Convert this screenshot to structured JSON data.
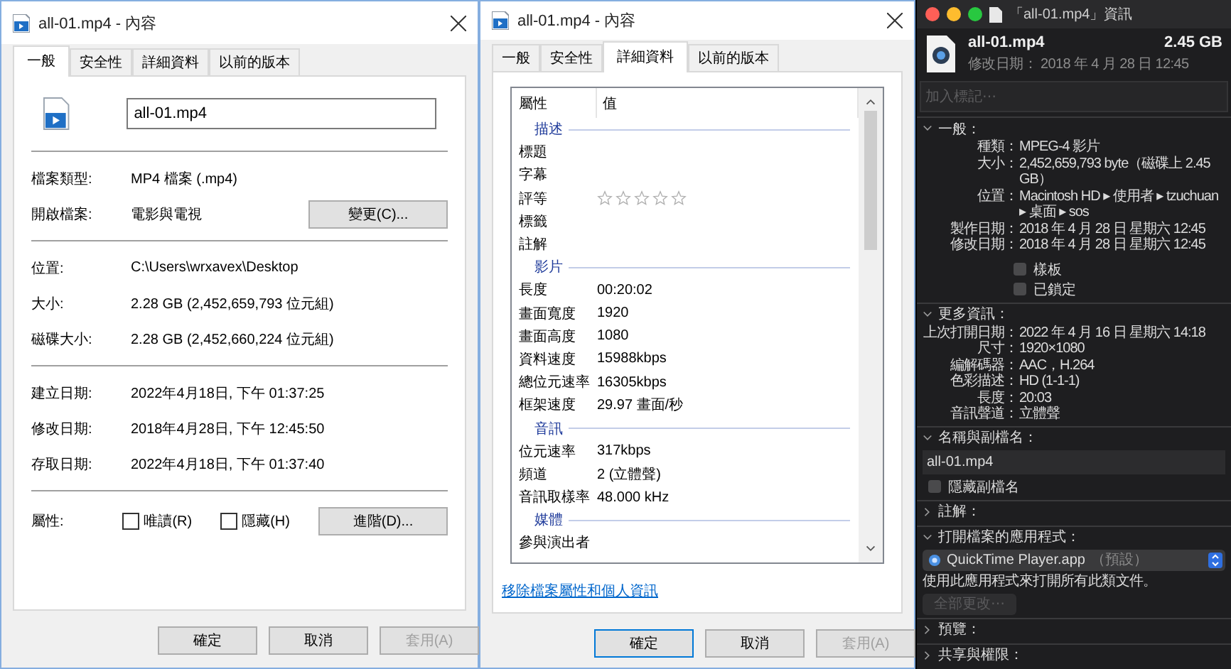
{
  "general_dialog": {
    "title": "all-01.mp4 - 內容",
    "tabs": [
      {
        "label": "一般",
        "selected": true
      },
      {
        "label": "安全性",
        "selected": false
      },
      {
        "label": "詳細資料",
        "selected": false
      },
      {
        "label": "以前的版本",
        "selected": false
      }
    ],
    "file_name": "all-01.mp4",
    "sections": [
      [
        {
          "label": "檔案類型:",
          "value": "MP4 檔案 (.mp4)"
        },
        {
          "label": "開啟檔案:",
          "value": "電影與電視",
          "button": "變更(C)..."
        }
      ],
      [
        {
          "label": "位置:",
          "value": "C:\\Users\\wrxavex\\Desktop"
        },
        {
          "label": "大小:",
          "value": "2.28 GB (2,452,659,793 位元組)"
        },
        {
          "label": "磁碟大小:",
          "value": "2.28 GB (2,452,660,224 位元組)"
        }
      ],
      [
        {
          "label": "建立日期:",
          "value": "2022年4月18日, 下午 01:37:25"
        },
        {
          "label": "修改日期:",
          "value": "2018年4月28日, 下午 12:45:50"
        },
        {
          "label": "存取日期:",
          "value": "2022年4月18日, 下午 01:37:40"
        }
      ]
    ],
    "attributes": {
      "label": "屬性:",
      "checkboxes": [
        {
          "label": "唯讀(R)",
          "checked": false
        },
        {
          "label": "隱藏(H)",
          "checked": false
        }
      ],
      "button": "進階(D)..."
    },
    "buttons": [
      {
        "label": "確定",
        "default": false,
        "disabled": false
      },
      {
        "label": "取消",
        "default": false,
        "disabled": false
      },
      {
        "label": "套用(A)",
        "default": false,
        "disabled": true
      }
    ]
  },
  "details_dialog": {
    "title": "all-01.mp4 - 內容",
    "tabs": [
      {
        "label": "一般",
        "selected": false
      },
      {
        "label": "安全性",
        "selected": false
      },
      {
        "label": "詳細資料",
        "selected": true
      },
      {
        "label": "以前的版本",
        "selected": false
      }
    ],
    "columns": [
      "屬性",
      "值"
    ],
    "groups": [
      {
        "name": "描述",
        "rows": [
          {
            "kind": "text",
            "label": "標題"
          },
          {
            "kind": "text",
            "label": "字幕"
          },
          {
            "kind": "stars",
            "label": "評等",
            "stars": 0
          },
          {
            "kind": "text",
            "label": "標籤"
          },
          {
            "kind": "text",
            "label": "註解"
          }
        ]
      },
      {
        "name": "影片",
        "rows": [
          {
            "kind": "text",
            "label": "長度",
            "value": "00:20:02"
          },
          {
            "kind": "text",
            "label": "畫面寬度",
            "value": "1920"
          },
          {
            "kind": "text",
            "label": "畫面高度",
            "value": "1080"
          },
          {
            "kind": "text",
            "label": "資料速度",
            "value": "15988kbps"
          },
          {
            "kind": "text",
            "label": "總位元速率",
            "value": "16305kbps"
          },
          {
            "kind": "text",
            "label": "框架速度",
            "value": "29.97 畫面/秒"
          }
        ]
      },
      {
        "name": "音訊",
        "rows": [
          {
            "kind": "text",
            "label": "位元速率",
            "value": "317kbps"
          },
          {
            "kind": "text",
            "label": "頻道",
            "value": "2 (立體聲)"
          },
          {
            "kind": "text",
            "label": "音訊取樣率",
            "value": "48.000 kHz"
          }
        ]
      },
      {
        "name": "媒體",
        "rows": [
          {
            "kind": "text",
            "label": "參與演出者"
          }
        ]
      }
    ],
    "link": "移除檔案屬性和個人資訊",
    "buttons": [
      {
        "label": "確定",
        "default": true,
        "disabled": false
      },
      {
        "label": "取消",
        "default": false,
        "disabled": false
      },
      {
        "label": "套用(A)",
        "default": false,
        "disabled": true
      }
    ]
  },
  "info_panel": {
    "title": "「all-01.mp4」資訊",
    "file_name": "all-01.mp4",
    "size": "2.45 GB",
    "modified": "修改日期： 2018 年 4 月 28 日 12:45",
    "tags_placeholder": "加入標記⋯",
    "sections": [
      {
        "kind": "info",
        "title": "一般：",
        "expanded": true,
        "rows": [
          {
            "label": "種類：",
            "value": "MPEG-4 影片"
          },
          {
            "label": "大小：",
            "value": "2,452,659,793 byte（磁碟上 2.45 GB）"
          },
          {
            "label": "位置：",
            "value": "Macintosh HD ▸ 使用者 ▸ tzuchuan ▸ 桌面 ▸ sos"
          },
          {
            "label": "製作日期：",
            "value": "2018 年 4 月 28 日 星期六 12:45"
          },
          {
            "label": "修改日期：",
            "value": "2018 年 4 月 28 日 星期六 12:45"
          }
        ],
        "checkboxes": [
          {
            "label": "樣板",
            "checked": false
          },
          {
            "label": "已鎖定",
            "checked": false
          }
        ]
      },
      {
        "kind": "info",
        "title": "更多資訊：",
        "expanded": true,
        "rows": [
          {
            "label": "上次打開日期：",
            "value": "2022 年 4 月 16 日 星期六 14:18"
          },
          {
            "label": "尺寸：",
            "value": "1920×1080"
          },
          {
            "label": "編解碼器：",
            "value": "AAC，H.264"
          },
          {
            "label": "色彩描述：",
            "value": "HD (1-1-1)"
          },
          {
            "label": "長度：",
            "value": "20:03"
          },
          {
            "label": "音訊聲道：",
            "value": "立體聲"
          }
        ]
      },
      {
        "kind": "name",
        "title": "名稱與副檔名：",
        "expanded": true,
        "field": "all-01.mp4",
        "checkbox": {
          "label": "隱藏副檔名",
          "checked": false
        }
      },
      {
        "title": "註解：",
        "expanded": false
      },
      {
        "kind": "open_with",
        "title": "打開檔案的應用程式：",
        "expanded": true,
        "app": "QuickTime Player.app",
        "app_note": "（預設）",
        "note": "使用此應用程式來打開所有此類文件。",
        "button": "全部更改⋯",
        "button_disabled": true
      },
      {
        "title": "預覽：",
        "expanded": false
      },
      {
        "title": "共享與權限：",
        "expanded": false
      }
    ]
  }
}
